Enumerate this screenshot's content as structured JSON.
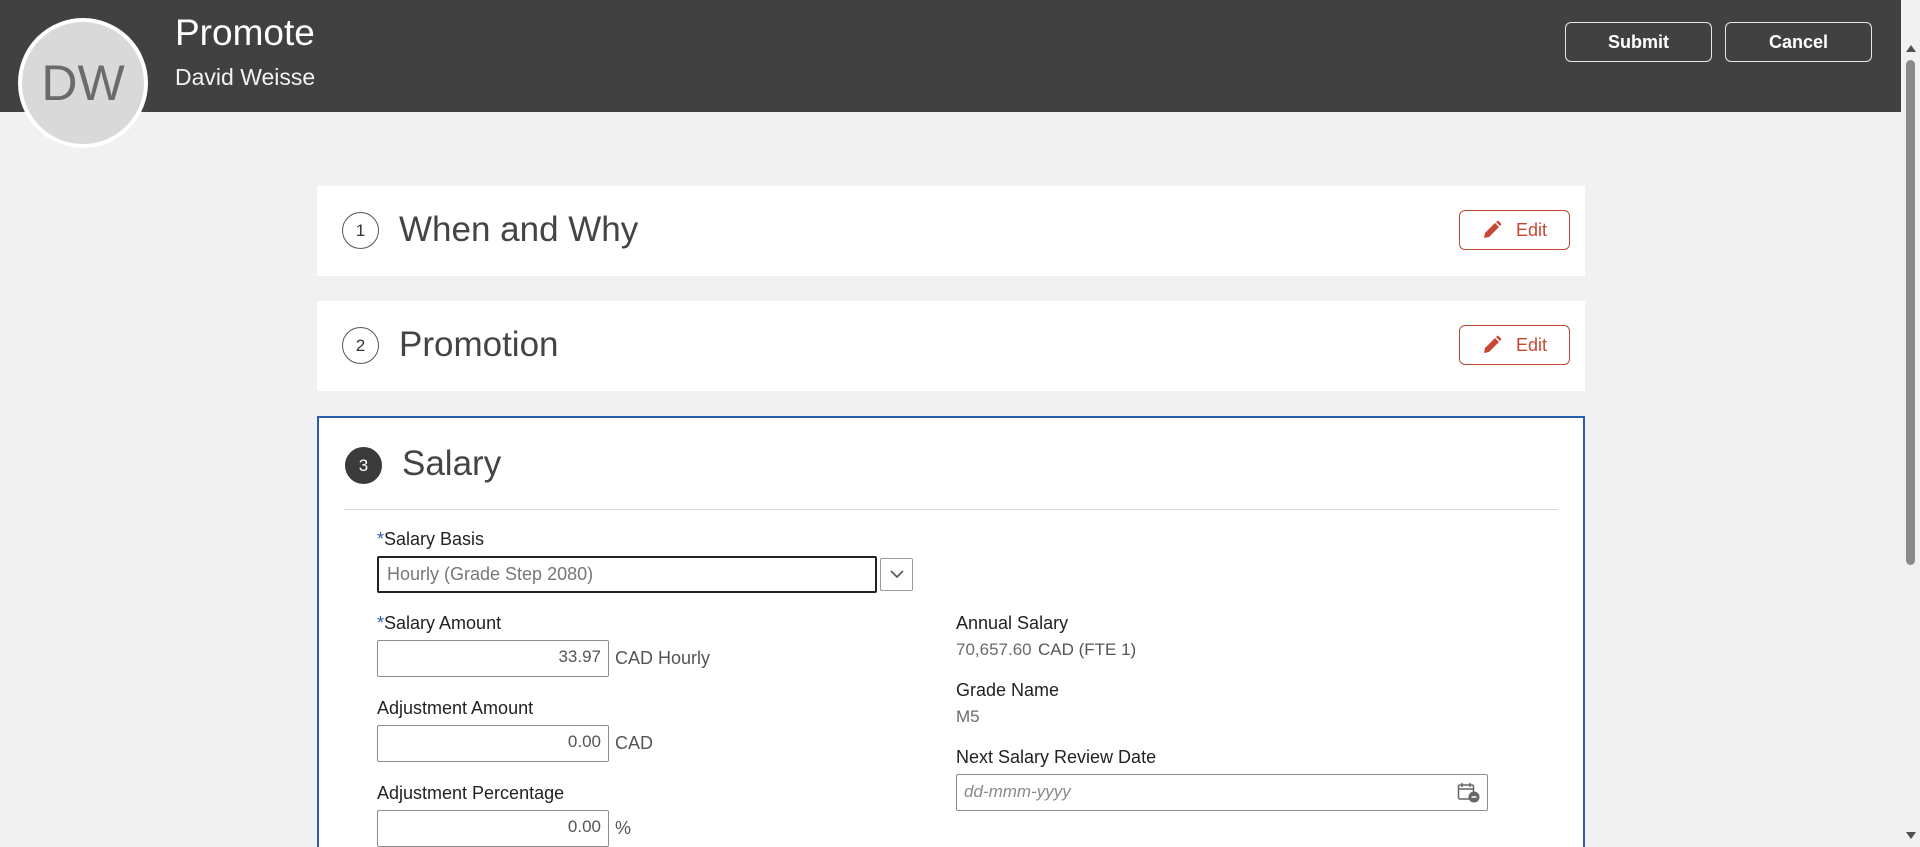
{
  "header": {
    "avatar_initials": "DW",
    "title": "Promote",
    "subtitle": "David Weisse",
    "submit_label": "Submit",
    "cancel_label": "Cancel"
  },
  "sections": [
    {
      "number": "1",
      "title": "When and Why",
      "edit_label": "Edit"
    },
    {
      "number": "2",
      "title": "Promotion",
      "edit_label": "Edit"
    },
    {
      "number": "3",
      "title": "Salary"
    }
  ],
  "salary": {
    "required_marker": "*",
    "salary_basis": {
      "label": "Salary Basis",
      "value": "Hourly (Grade Step 2080)"
    },
    "salary_amount": {
      "label": "Salary Amount",
      "value": "33.97",
      "unit": "CAD Hourly"
    },
    "adjustment_amount": {
      "label": "Adjustment Amount",
      "value": "0.00",
      "unit": "CAD"
    },
    "adjustment_percentage": {
      "label": "Adjustment Percentage",
      "value": "0.00",
      "unit": "%"
    },
    "annual_salary": {
      "label": "Annual Salary",
      "value": "70,657.60",
      "unit": "CAD (FTE 1)"
    },
    "grade_name": {
      "label": "Grade Name",
      "value": "M5"
    },
    "next_review_date": {
      "label": "Next Salary Review Date",
      "placeholder": "dd-mmm-yyyy"
    }
  },
  "colors": {
    "header_bg": "#414141",
    "accent_red": "#c74634",
    "active_border": "#2a5db0",
    "page_bg": "#f1f1f1"
  },
  "icons": [
    "pencil-icon",
    "chevron-down-icon",
    "calendar-icon"
  ]
}
